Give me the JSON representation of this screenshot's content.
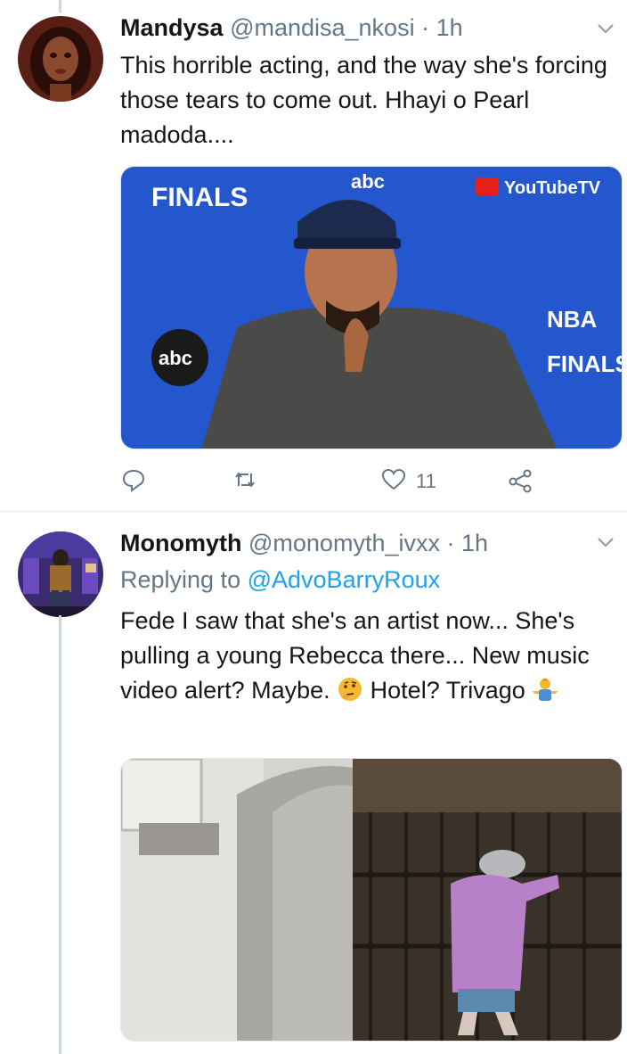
{
  "tweets": [
    {
      "name": "Mandysa",
      "handle": "@mandisa_nkosi",
      "separator": "·",
      "time": "1h",
      "text": "This horrible acting, and the way she's forcing those tears to come out. Hhayi o Pearl madoda....",
      "media": {
        "overlay_texts": [
          "FINALS",
          "abc",
          "YouTubeTV",
          "NBA",
          "FINALS",
          "abc"
        ]
      },
      "actions": {
        "reply_count": "",
        "retweet_count": "",
        "like_count": "11"
      }
    },
    {
      "name": "Monomyth",
      "handle": "@monomyth_ivxx",
      "separator": "·",
      "time": "1h",
      "replying_label": "Replying to",
      "replying_to": "@AdvoBarryRoux",
      "text_part1": "Fede I saw that she's an artist now... She's pulling a young Rebecca there... New music video alert? Maybe.",
      "text_part2": " Hotel? Trivago ",
      "emoji": [
        "thinking-face",
        "man-shrugging"
      ]
    }
  ],
  "colors": {
    "accent": "#1da1f2",
    "secondary_text": "#657786",
    "primary_text": "#14171a",
    "divider": "#e1e8ed",
    "thread_line": "#ccd6dd"
  }
}
